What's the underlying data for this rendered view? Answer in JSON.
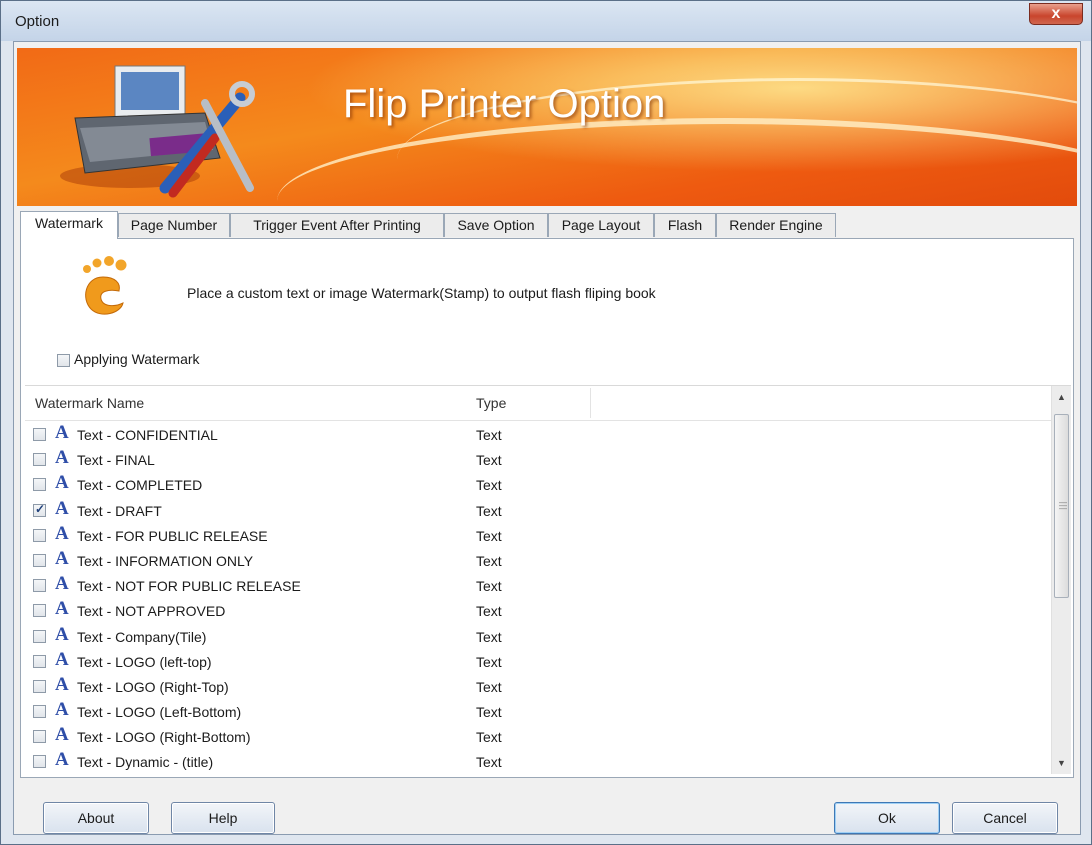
{
  "window": {
    "title": "Option",
    "close_label": "x"
  },
  "banner": {
    "title": "Flip Printer Option"
  },
  "tabs": [
    {
      "label": "Watermark",
      "active": true
    },
    {
      "label": "Page Number"
    },
    {
      "label": "Trigger Event After Printing"
    },
    {
      "label": "Save Option"
    },
    {
      "label": "Page Layout"
    },
    {
      "label": "Flash"
    },
    {
      "label": "Render Engine"
    }
  ],
  "watermark": {
    "description": "Place a custom text or image Watermark(Stamp) to output flash fliping book",
    "apply_label": "Applying Watermark",
    "apply_checked": false,
    "columns": {
      "name": "Watermark Name",
      "type": "Type"
    },
    "rows": [
      {
        "name": "Text - CONFIDENTIAL",
        "type": "Text",
        "checked": false
      },
      {
        "name": "Text - FINAL",
        "type": "Text",
        "checked": false
      },
      {
        "name": "Text - COMPLETED",
        "type": "Text",
        "checked": false
      },
      {
        "name": "Text - DRAFT",
        "type": "Text",
        "checked": true
      },
      {
        "name": "Text - FOR PUBLIC RELEASE",
        "type": "Text",
        "checked": false
      },
      {
        "name": "Text - INFORMATION ONLY",
        "type": "Text",
        "checked": false
      },
      {
        "name": "Text - NOT FOR PUBLIC RELEASE",
        "type": "Text",
        "checked": false
      },
      {
        "name": "Text - NOT APPROVED",
        "type": "Text",
        "checked": false
      },
      {
        "name": "Text - Company(Tile)",
        "type": "Text",
        "checked": false
      },
      {
        "name": "Text - LOGO (left-top)",
        "type": "Text",
        "checked": false
      },
      {
        "name": "Text - LOGO (Right-Top)",
        "type": "Text",
        "checked": false
      },
      {
        "name": "Text - LOGO (Left-Bottom)",
        "type": "Text",
        "checked": false
      },
      {
        "name": "Text - LOGO (Right-Bottom)",
        "type": "Text",
        "checked": false
      },
      {
        "name": "Text - Dynamic - (title)",
        "type": "Text",
        "checked": false
      }
    ]
  },
  "buttons": {
    "about": "About",
    "help": "Help",
    "ok": "Ok",
    "cancel": "Cancel"
  }
}
